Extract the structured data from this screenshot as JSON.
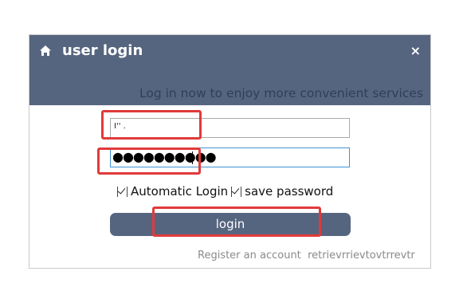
{
  "dialog": {
    "title": "user login",
    "close_glyph": "×",
    "subtitle": "Log in now to enjoy more convenient services",
    "icon": "home-icon",
    "header_color": "#56657f"
  },
  "form": {
    "username_value": "I'' .",
    "password_value": "●●●●●●●●●●",
    "auto_login_label": "Automatic Login",
    "save_password_label": "save password",
    "login_button_label": "login"
  },
  "footer": {
    "register_label": "Register an account",
    "retrieve_label": "retrievrrievtovtrrevtr"
  },
  "annotations": {
    "highlight_color": "#e13a3a"
  }
}
